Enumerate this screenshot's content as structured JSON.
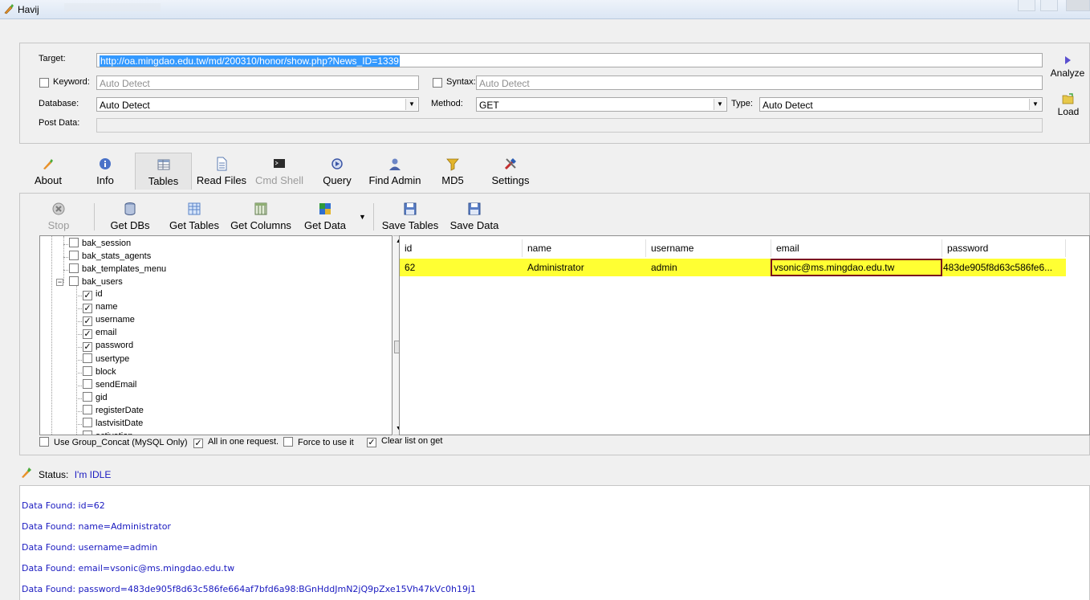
{
  "window": {
    "title": "Havij"
  },
  "target": {
    "label": "Target:",
    "url": "http://oa.mingdao.edu.tw/md/200310/honor/show.php?News_ID=1339",
    "keyword_label": "Keyword:",
    "keyword_placeholder": "Auto Detect",
    "keyword_checked": false,
    "syntax_label": "Syntax:",
    "syntax_placeholder": "Auto Detect",
    "syntax_checked": false,
    "database_label": "Database:",
    "database_value": "Auto Detect",
    "method_label": "Method:",
    "method_value": "GET",
    "type_label": "Type:",
    "type_value": "Auto Detect",
    "postdata_label": "Post Data:",
    "analyze_label": "Analyze",
    "load_label": "Load"
  },
  "tabs": [
    {
      "label": "About",
      "icon": "about-icon",
      "active": false,
      "disabled": false
    },
    {
      "label": "Info",
      "icon": "info-icon",
      "active": false,
      "disabled": false
    },
    {
      "label": "Tables",
      "icon": "tables-icon",
      "active": true,
      "disabled": false
    },
    {
      "label": "Read Files",
      "icon": "file-icon",
      "active": false,
      "disabled": false
    },
    {
      "label": "Cmd Shell",
      "icon": "terminal-icon",
      "active": false,
      "disabled": true
    },
    {
      "label": "Query",
      "icon": "query-icon",
      "active": false,
      "disabled": false
    },
    {
      "label": "Find Admin",
      "icon": "admin-icon",
      "active": false,
      "disabled": false
    },
    {
      "label": "MD5",
      "icon": "md5-icon",
      "active": false,
      "disabled": false
    },
    {
      "label": "Settings",
      "icon": "settings-icon",
      "active": false,
      "disabled": false
    }
  ],
  "toolbar": {
    "stop": "Stop",
    "get_dbs": "Get DBs",
    "get_tables": "Get Tables",
    "get_columns": "Get Columns",
    "get_data": "Get Data",
    "save_tables": "Save Tables",
    "save_data": "Save Data"
  },
  "tree": {
    "items": [
      {
        "label": "bak_session",
        "checked": false,
        "level": 1
      },
      {
        "label": "bak_stats_agents",
        "checked": false,
        "level": 1
      },
      {
        "label": "bak_templates_menu",
        "checked": false,
        "level": 1
      },
      {
        "label": "bak_users",
        "checked": false,
        "level": 1,
        "expanded": true
      },
      {
        "label": "id",
        "checked": true,
        "level": 2
      },
      {
        "label": "name",
        "checked": true,
        "level": 2
      },
      {
        "label": "username",
        "checked": true,
        "level": 2
      },
      {
        "label": "email",
        "checked": true,
        "level": 2
      },
      {
        "label": "password",
        "checked": true,
        "level": 2
      },
      {
        "label": "usertype",
        "checked": false,
        "level": 2
      },
      {
        "label": "block",
        "checked": false,
        "level": 2
      },
      {
        "label": "sendEmail",
        "checked": false,
        "level": 2
      },
      {
        "label": "gid",
        "checked": false,
        "level": 2
      },
      {
        "label": "registerDate",
        "checked": false,
        "level": 2
      },
      {
        "label": "lastvisitDate",
        "checked": false,
        "level": 2
      },
      {
        "label": "activation",
        "checked": false,
        "level": 2
      }
    ]
  },
  "grid": {
    "columns": [
      "id",
      "name",
      "username",
      "email",
      "password"
    ],
    "rows": [
      [
        "62",
        "Administrator",
        "admin",
        "vsonic@ms.mingdao.edu.tw",
        "483de905f8d63c586fe6..."
      ]
    ],
    "highlight_color": "#ffff33"
  },
  "options": [
    {
      "label": "Use Group_Concat (MySQL Only)",
      "checked": false
    },
    {
      "label": "All in one request.",
      "checked": true
    },
    {
      "label": "Force to use it",
      "checked": false
    },
    {
      "label": "Clear list on get",
      "checked": true
    }
  ],
  "status": {
    "label": "Status:",
    "value": "I'm IDLE"
  },
  "log": [
    "Data Found: id=62",
    "Data Found: name=Administrator",
    "Data Found: username=admin",
    "Data Found: email=vsonic@ms.mingdao.edu.tw",
    "Data Found: password=483de905f8d63c586fe664af7bfd6a98:BGnHddJmN2jQ9pZxe15Vh47kVc0h19j1"
  ],
  "colors": {
    "log_text": "#1a1ac0",
    "selection": "#3399ff",
    "cell_border": "#7b0e1e"
  }
}
